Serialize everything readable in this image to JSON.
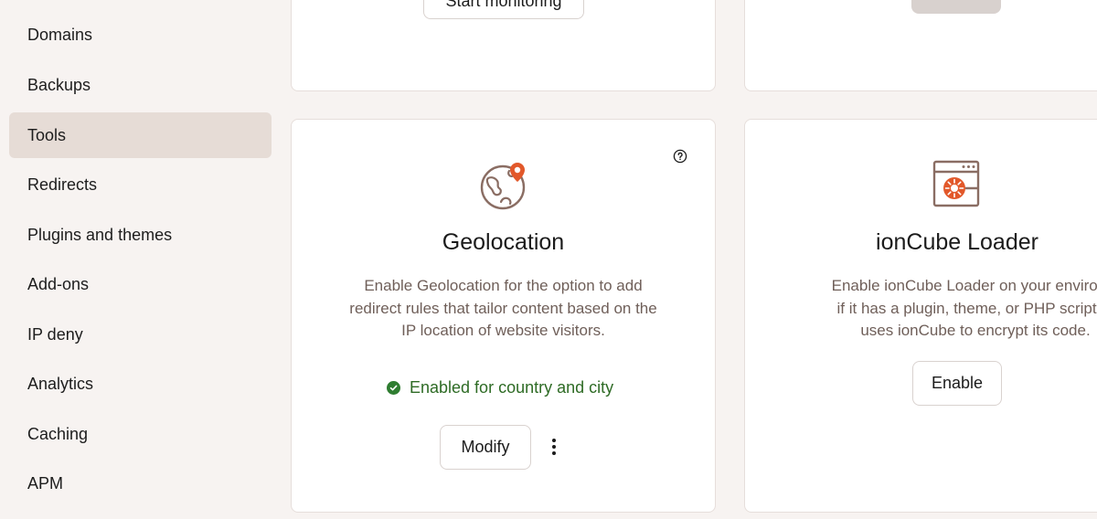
{
  "sidebar": {
    "items": [
      {
        "label": "Domains",
        "active": false
      },
      {
        "label": "Backups",
        "active": false
      },
      {
        "label": "Tools",
        "active": true
      },
      {
        "label": "Redirects",
        "active": false
      },
      {
        "label": "Plugins and themes",
        "active": false
      },
      {
        "label": "Add-ons",
        "active": false
      },
      {
        "label": "IP deny",
        "active": false
      },
      {
        "label": "Analytics",
        "active": false
      },
      {
        "label": "Caching",
        "active": false
      },
      {
        "label": "APM",
        "active": false
      }
    ]
  },
  "top_cards": {
    "left_button_label": "Start monitoring"
  },
  "geolocation": {
    "title": "Geolocation",
    "description_lines": [
      "Enable Geolocation for the option to add",
      "redirect rules that tailor content based on the",
      "IP location of website visitors."
    ],
    "status_text": "Enabled for country and city",
    "modify_label": "Modify",
    "help_icon": "question-circle-icon",
    "icon": "globe-pin-icon"
  },
  "ioncube": {
    "title": "ionCube Loader",
    "description_lines": [
      "Enable ionCube Loader on your environm",
      "if it has a plugin, theme, or PHP script th",
      "uses ionCube to encrypt its code."
    ],
    "enable_label": "Enable",
    "icon": "browser-window-icon"
  },
  "colors": {
    "background": "#f7f3f1",
    "active_nav": "#e6dcd6",
    "accent_orange": "#e2582a",
    "status_green": "#2e6b25",
    "icon_brown": "#8a6d63"
  }
}
